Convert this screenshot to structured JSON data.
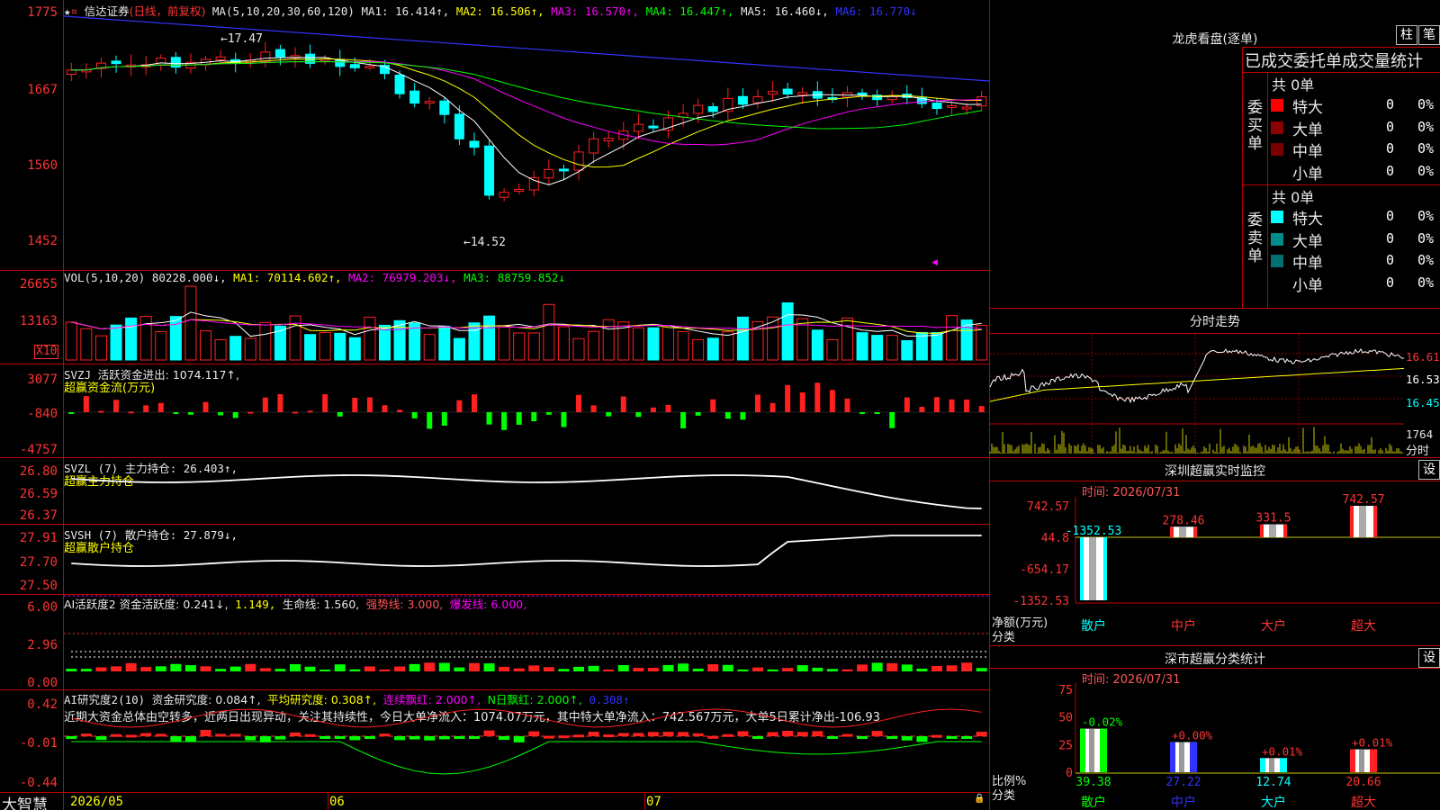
{
  "colors": {
    "up": "#ff2020",
    "down": "#00ffff",
    "bg": "#000000",
    "grid": "#c00000",
    "ma1": "#ffffff",
    "ma2": "#ffff00",
    "ma3": "#ff00ff",
    "ma4": "#00ff00",
    "ma6": "#3333ff"
  },
  "main": {
    "title": "信达证券",
    "period": "(日线，前复权)",
    "ma_label": "MA(5,10,20,30,60,120)",
    "ma1": "MA1: 16.414↑,",
    "ma2": "MA2: 16.506↑,",
    "ma3": "MA3: 16.570↑,",
    "ma4": "MA4: 16.447↑,",
    "ma5": "MA5: 16.460↓,",
    "ma6": "MA6: 16.770↓",
    "high_label": "←17.47",
    "low_label": "←14.52",
    "yticks": [
      "1775",
      "1667",
      "1560",
      "1452"
    ]
  },
  "vol": {
    "label": "VOL(5,10,20)",
    "value": "80228.000↓,",
    "ma1": "MA1: 70114.602↑,",
    "ma2": "MA2: 76979.203↓,",
    "ma3": "MA3: 88759.852↓",
    "yticks": [
      "26655",
      "13163"
    ],
    "unit": "X10"
  },
  "svzj": {
    "label": "SVZJ",
    "desc": "活跃资金进出: 1074.117↑,",
    "sub": "超赢资金流(万元)",
    "yticks": [
      "3077",
      "-840",
      "-4757"
    ]
  },
  "svzl": {
    "label": "SVZL (7) 主力持仓: 26.403↑,",
    "sub": "超赢主力持仓",
    "yticks": [
      "26.80",
      "26.59",
      "26.37"
    ]
  },
  "svsh": {
    "label": "SVSH (7) 散户持仓: 27.879↓,",
    "sub": "超赢散户持仓",
    "yticks": [
      "27.91",
      "27.70",
      "27.50"
    ]
  },
  "ai1": {
    "label": "AI活跃度2 资金活跃度: 0.241↓,",
    "v2": "1.149,",
    "v3": "生命线: 1.560,",
    "v4": "强势线: 3.000,",
    "v5": "爆发线: 6.000,",
    "yticks": [
      "6.00",
      "2.96",
      "0.00"
    ]
  },
  "ai2": {
    "label": "AI研究度2(10)",
    "v1": "资金研究度: 0.084↑,",
    "v2": "平均研究度: 0.308↑,",
    "v3": "连续飘红: 2.000↑,",
    "v4": "N日飘红: 2.000↑,",
    "v5": "0.308↑",
    "comment": "近期大资金总体由空转多，近两日出现异动，关注其持续性，今日大单净流入：1074.07万元，其中特大单净流入：742.567万元，大单5日累计净出-106.93",
    "yticks": [
      "0.42",
      "-0.01",
      "-0.44"
    ]
  },
  "xaxis": {
    "brand": "大智慧",
    "labels": [
      "2026/05",
      "06",
      "07"
    ]
  },
  "lhb": {
    "title": "龙虎看盘(逐单)",
    "btn1": "柱",
    "btn2": "笔",
    "header": "已成交委托单成交量统计",
    "buy_title": "委买单",
    "buy_total": "共 0单",
    "sell_title": "委卖单",
    "sell_total": "共 0单",
    "buy_rows": [
      {
        "label": "特大",
        "val": "0",
        "pct": "0%",
        "color": "#ff0000"
      },
      {
        "label": "大单",
        "val": "0",
        "pct": "0%",
        "color": "#8b0000"
      },
      {
        "label": "中单",
        "val": "0",
        "pct": "0%",
        "color": "#7a0000"
      },
      {
        "label": "小单",
        "val": "0",
        "pct": "0%",
        "color": ""
      }
    ],
    "sell_rows": [
      {
        "label": "特大",
        "val": "0",
        "pct": "0%",
        "color": "#00ffff"
      },
      {
        "label": "大单",
        "val": "0",
        "pct": "0%",
        "color": "#008b8b"
      },
      {
        "label": "中单",
        "val": "0",
        "pct": "0%",
        "color": "#007070"
      },
      {
        "label": "小单",
        "val": "0",
        "pct": "0%",
        "color": ""
      }
    ]
  },
  "fenshi": {
    "title": "分时走势",
    "prices": [
      "16.61",
      "16.53",
      "16.45"
    ],
    "vol": "1764",
    "vol_label": "分时"
  },
  "sz_monitor": {
    "title": "深圳超赢实时监控",
    "btn": "设",
    "time": "时间: 2026/07/31",
    "yticks": [
      "742.57",
      "44.8",
      "-654.17",
      "-1352.53"
    ],
    "ylabel1": "净额(万元)",
    "ylabel2": "分类",
    "bars": [
      {
        "name": "散户",
        "value": -1352.53,
        "label": "-1352.53"
      },
      {
        "name": "中户",
        "value": 278.46,
        "label": "278.46"
      },
      {
        "name": "大户",
        "value": 331.5,
        "label": "331.5"
      },
      {
        "name": "超大",
        "value": 742.57,
        "label": "742.57"
      }
    ]
  },
  "sz_class": {
    "title": "深市超赢分类统计",
    "btn": "设",
    "time": "时间: 2026/07/31",
    "yticks": [
      "75",
      "50",
      "25",
      "0"
    ],
    "ylabel1": "比例%",
    "ylabel2": "分类",
    "bars": [
      {
        "name": "散户",
        "value": 39.38,
        "top": "-0.02%",
        "color": "#00ff00"
      },
      {
        "name": "中户",
        "value": 27.22,
        "top": "+0.00%",
        "color": "#3333ff"
      },
      {
        "name": "大户",
        "value": 12.74,
        "top": "+0.01%",
        "color": "#00ffff"
      },
      {
        "name": "超大",
        "value": 20.66,
        "top": "+0.01%",
        "color": "#ff2020"
      }
    ]
  }
}
